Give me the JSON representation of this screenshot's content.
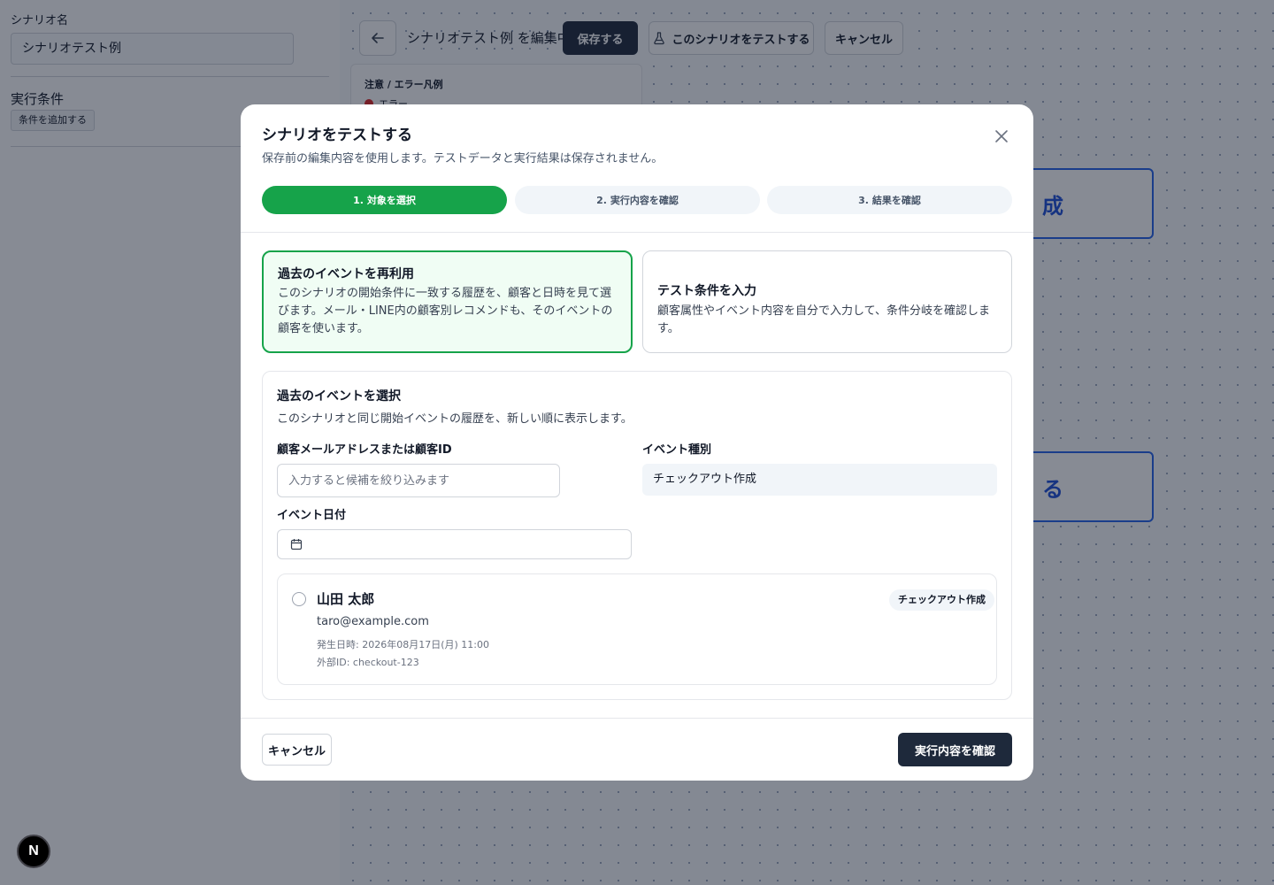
{
  "sidebar": {
    "scenario_name_label": "シナリオ名",
    "scenario_name_value": "シナリオテスト例",
    "conditions_label": "実行条件",
    "add_condition_label": "条件を追加する"
  },
  "toolbar": {
    "editing_title": "シナリオテスト例 を編集中",
    "save_label": "保存する",
    "test_label": "このシナリオをテストする",
    "cancel_label": "キャンセル"
  },
  "legend": {
    "title": "注意 / エラー凡例",
    "error_label": "エラー"
  },
  "canvas_nodes": [
    {
      "label": "成"
    },
    {
      "label": "る"
    }
  ],
  "badge": {
    "label": "N"
  },
  "modal": {
    "title": "シナリオをテストする",
    "subtitle": "保存前の編集内容を使用します。テストデータと実行結果は保存されません。",
    "steps": [
      {
        "label": "1. 対象を選択",
        "active": true
      },
      {
        "label": "2. 実行内容を確認",
        "active": false
      },
      {
        "label": "3. 結果を確認",
        "active": false
      }
    ],
    "options": [
      {
        "title": "過去のイベントを再利用",
        "description": "このシナリオの開始条件に一致する履歴を、顧客と日時を見て選びます。メール・LINE内の顧客別レコメンドも、そのイベントの顧客を使います。",
        "selected": true
      },
      {
        "title": "テスト条件を入力",
        "description": "顧客属性やイベント内容を自分で入力して、条件分岐を確認します。",
        "selected": false
      }
    ],
    "section": {
      "title": "過去のイベントを選択",
      "description": "このシナリオと同じ開始イベントの履歴を、新しい順に表示します。",
      "customer_label": "顧客メールアドレスまたは顧客ID",
      "customer_value": "",
      "customer_placeholder": "入力すると候補を絞り込みます",
      "event_type_label": "イベント種別",
      "event_type_value": "チェックアウト作成",
      "event_date_label": "イベント日付",
      "event_date_value": ""
    },
    "events": [
      {
        "name": "山田 太郎",
        "email": "taro@example.com",
        "occurred_at": "発生日時: 2026年08月17日(月) 11:00",
        "external_id": "外部ID: checkout-123",
        "event_type": "チェックアウト作成",
        "selected": false
      }
    ],
    "footer": {
      "cancel_label": "キャンセル",
      "confirm_label": "実行内容を確認"
    }
  },
  "colors": {
    "accent_green": "#16a34a",
    "dark_button": "#1e293b",
    "node_blue": "#2563eb",
    "error_red": "#dc2626"
  }
}
